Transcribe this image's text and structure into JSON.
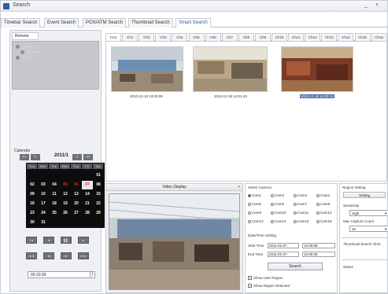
{
  "window": {
    "title": "Search",
    "min_glyph": "_",
    "close_glyph": "×"
  },
  "tabs": [
    "Timebar Search",
    "Event Search",
    "POS/ATM Search",
    "Thumbnail Search",
    "Smart Search"
  ],
  "active_tab": 4,
  "left": {
    "remote_tab": "Remote",
    "calendar_label": "Calendar",
    "month": "2011/1",
    "nav_prev2": "<<",
    "nav_prev": "<",
    "nav_next": ">",
    "nav_next2": ">>",
    "weekdays": [
      "Sun",
      "Mon",
      "Tue",
      "Wed",
      "Thu",
      "Fri",
      "Sat"
    ],
    "weeks": [
      [
        "",
        "",
        "",
        "",
        "",
        "",
        "01"
      ],
      [
        "02",
        "03",
        "04",
        "05",
        "06",
        "07",
        "08"
      ],
      [
        "09",
        "10",
        "11",
        "12",
        "13",
        "14",
        "15"
      ],
      [
        "16",
        "17",
        "18",
        "19",
        "20",
        "21",
        "22"
      ],
      [
        "23",
        "24",
        "25",
        "26",
        "27",
        "28",
        "29"
      ],
      [
        "30",
        "31",
        "",
        "",
        "",
        "",
        ""
      ]
    ],
    "red_days": [
      "05",
      "06"
    ],
    "selected_day": "07",
    "playback_buttons": [
      "|◄",
      "◄",
      "▌▌",
      "►",
      "◄◄",
      "◄|",
      "|►",
      "►►"
    ],
    "time_value": "00:10:39"
  },
  "channels": [
    "CH1",
    "Ch1",
    "Ch2",
    "Ch3",
    "Ch4",
    "Ch5",
    "Ch6",
    "Ch7",
    "Ch8",
    "Ch9",
    "Ch10",
    "Ch11",
    "Ch12",
    "Ch13",
    "Ch14",
    "Ch15",
    "Ch16"
  ],
  "thumbnails": [
    {
      "timestamp": "2010-12-15 13:29:09",
      "highlight": false
    },
    {
      "timestamp": "2010-12-15 14:01:43",
      "highlight": false
    },
    {
      "timestamp": "2010-12-15 14:09:14",
      "highlight": true
    }
  ],
  "video_display": {
    "title": "Video Display",
    "close": "×"
  },
  "select_camera": {
    "title": "Select Camera",
    "cameras": [
      "Cam1",
      "Cam2",
      "Cam3",
      "Cam4",
      "Cam5",
      "Cam6",
      "Cam7",
      "Cam8",
      "Cam9",
      "Cam10",
      "Cam11",
      "Cam12",
      "Cam13",
      "Cam14",
      "Cam15",
      "Cam16"
    ],
    "selected": "Cam1",
    "datetime_title": "Date/Time Setting",
    "start_label": "Start Time",
    "start_date": "2011-01-07",
    "start_time": "12:09:58",
    "end_label": "End Time",
    "end_date": "2011-01-07",
    "end_time": "13:09:58",
    "search_button": "Search",
    "show_user_region": "Show User Region",
    "show_region_detected": "Show Region Detected",
    "checkbox_mark": "✓"
  },
  "region": {
    "title": "Region Setting",
    "setting_button": "Setting",
    "sensitivity_label": "Sensitivity",
    "sensitivity_value": "High",
    "max_capture_label": "Max Capture Count",
    "max_capture_value": "32",
    "thumb_time_label": "Thumbnail Search Time",
    "status_label": "Status"
  },
  "colors": {
    "accent": "#2c5aa0",
    "calendar_bg": "#0d0d0d",
    "red_day": "#d82a2a"
  }
}
